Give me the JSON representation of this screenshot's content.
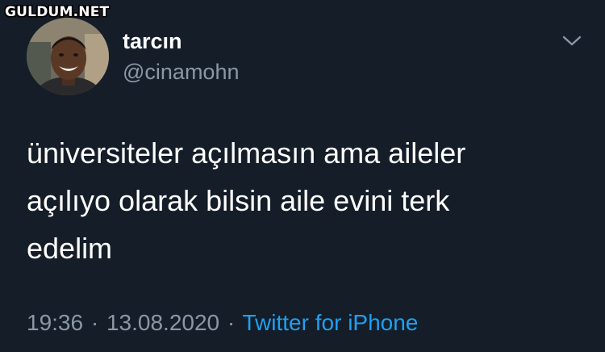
{
  "watermark": "GULDUM.NET",
  "user": {
    "name": "tarcın",
    "handle": "@cinamohn"
  },
  "tweet": {
    "lines": [
      "üniversiteler açılmasın ama aileler",
      "açılıyo olarak bilsin aile evini terk",
      "edelim"
    ],
    "time": "19:36",
    "date": "13.08.2020",
    "separator": "·",
    "source": "Twitter for iPhone"
  },
  "colors": {
    "background": "#151d28",
    "secondary_text": "#8a97a6",
    "link": "#1da1f2"
  },
  "icons": {
    "menu": "chevron-down-icon",
    "avatar": "profile-photo"
  }
}
